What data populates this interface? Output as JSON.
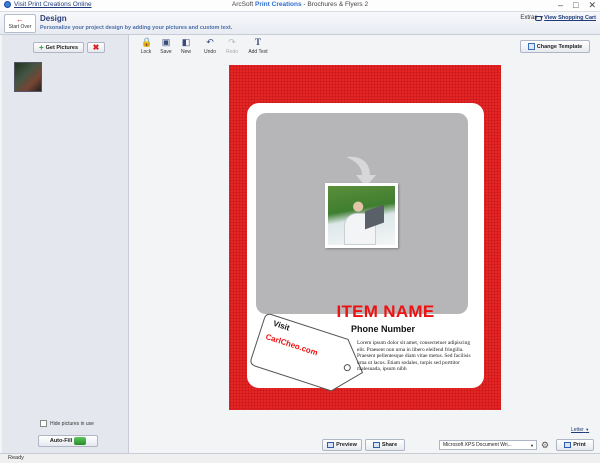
{
  "titlebar": {
    "visit_link": "Visit Print Creations Online",
    "app_prefix": "ArcSoft",
    "app_brand": "Print Creations",
    "app_suffix": "- Brochures & Flyers 2",
    "minimize": "–",
    "maximize": "□",
    "close": "✕"
  },
  "header": {
    "start_over_label": "Start Over",
    "title": "Design",
    "subtitle": "Personalize your project design by adding your pictures and custom text.",
    "extras_label": "Extras",
    "cart_label": "View Shopping Cart"
  },
  "left_panel": {
    "get_pictures_label": "Get Pictures",
    "hide_pictures_label": "Hide pictures in use",
    "auto_fill_label": "Auto-Fill"
  },
  "toolbar": {
    "lock_label": "Lock",
    "save_label": "Save",
    "new_label": "New",
    "undo_label": "Undo",
    "redo_label": "Redo",
    "add_text_label": "Add Text",
    "change_template_label": "Change Template"
  },
  "design": {
    "item_name": "ITEM NAME",
    "phone": "Phone Number",
    "body": "Lorem ipsum dolor sit amet, consectetuer adipiscing elit. Praesent non urna in libero eleifend fringilla. Praesent pellentesque diam vitae metus. Sed facilisis urna ut lacus. Etiam sodales, turpis sed porttitor malesuada, ipsum nibh",
    "tag_visit": "Visit",
    "tag_url": "CarlCheo.com",
    "paper_size": "Letter"
  },
  "bottom_bar": {
    "preview_label": "Preview",
    "share_label": "Share",
    "printer_value": "Microsoft XPS Document Wri...",
    "print_label": "Print"
  },
  "status": {
    "text": "Ready"
  },
  "colors": {
    "page_red": "#e32525",
    "accent_blue": "#2f6fcf"
  }
}
